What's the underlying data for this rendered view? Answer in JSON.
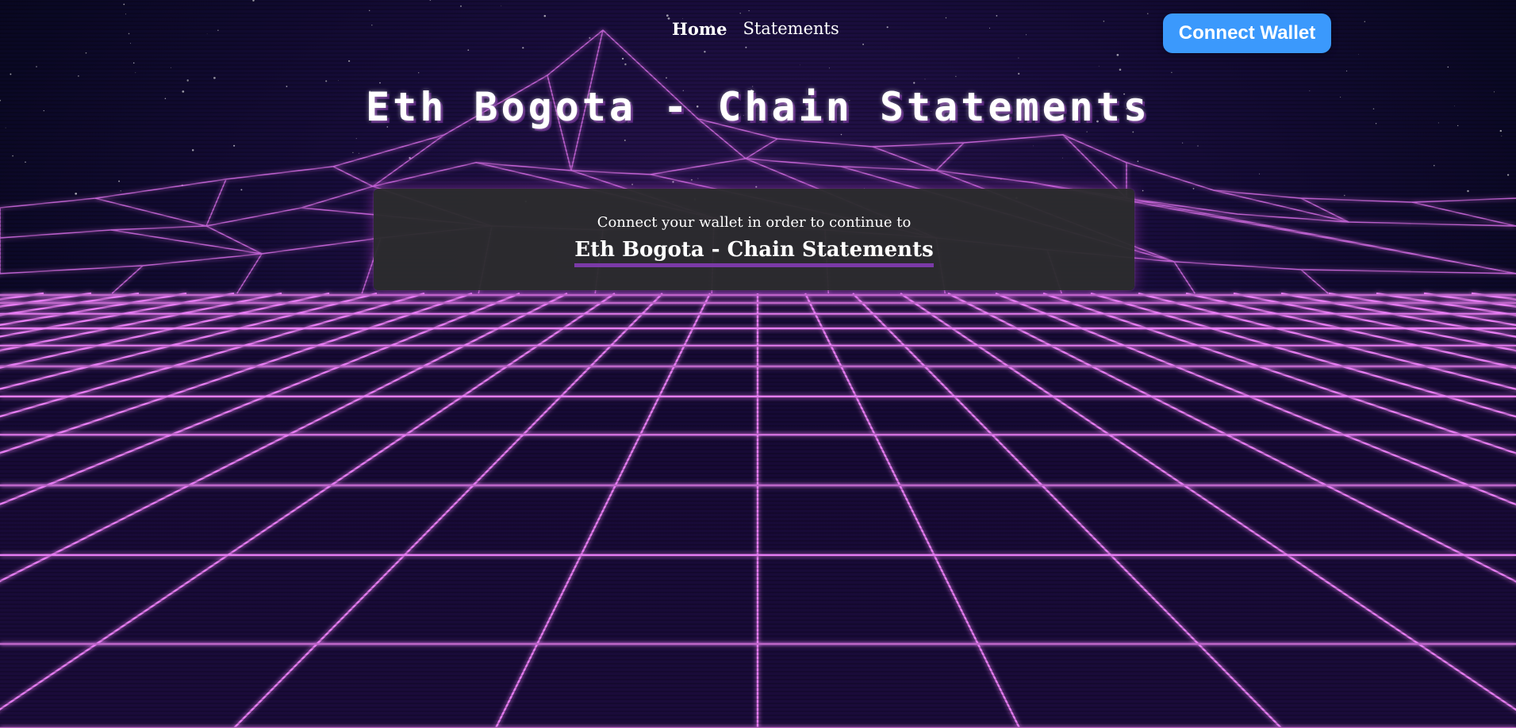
{
  "nav": {
    "items": [
      {
        "label": "Home",
        "active": true
      },
      {
        "label": "Statements",
        "active": false
      }
    ]
  },
  "header": {
    "connect_label": "Connect Wallet"
  },
  "hero": {
    "title": "Eth Bogota - Chain Statements"
  },
  "card": {
    "subtitle": "Connect your wallet in order to continue to",
    "app_name": "Eth Bogota - Chain Statements"
  },
  "colors": {
    "accent": "#3b99fc",
    "grid": "#e070f0",
    "underline": "#7b3aa8",
    "card_bg": "#2c2c2e"
  }
}
